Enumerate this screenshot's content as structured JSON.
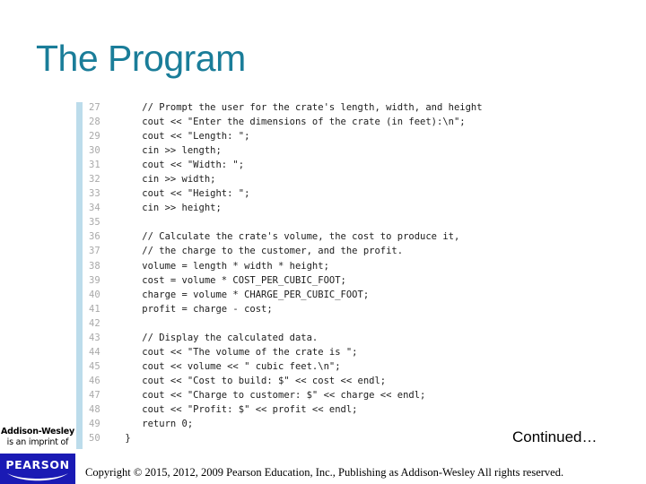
{
  "slide": {
    "title": "The Program",
    "title_color": "#1a7d99",
    "background_color": "#ffffff"
  },
  "code": {
    "left_rule_color": "#bcdceb",
    "line_number_color": "#a9a9a9",
    "text_color": "#1c1c1c",
    "lines": [
      {
        "number": "27",
        "text": "    // Prompt the user for the crate's length, width, and height"
      },
      {
        "number": "28",
        "text": "    cout << \"Enter the dimensions of the crate (in feet):\\n\";"
      },
      {
        "number": "29",
        "text": "    cout << \"Length: \";"
      },
      {
        "number": "30",
        "text": "    cin >> length;"
      },
      {
        "number": "31",
        "text": "    cout << \"Width: \";"
      },
      {
        "number": "32",
        "text": "    cin >> width;"
      },
      {
        "number": "33",
        "text": "    cout << \"Height: \";"
      },
      {
        "number": "34",
        "text": "    cin >> height;"
      },
      {
        "number": "35",
        "text": ""
      },
      {
        "number": "36",
        "text": "    // Calculate the crate's volume, the cost to produce it,"
      },
      {
        "number": "37",
        "text": "    // the charge to the customer, and the profit."
      },
      {
        "number": "38",
        "text": "    volume = length * width * height;"
      },
      {
        "number": "39",
        "text": "    cost = volume * COST_PER_CUBIC_FOOT;"
      },
      {
        "number": "40",
        "text": "    charge = volume * CHARGE_PER_CUBIC_FOOT;"
      },
      {
        "number": "41",
        "text": "    profit = charge - cost;"
      },
      {
        "number": "42",
        "text": ""
      },
      {
        "number": "43",
        "text": "    // Display the calculated data."
      },
      {
        "number": "44",
        "text": "    cout << \"The volume of the crate is \";"
      },
      {
        "number": "45",
        "text": "    cout << volume << \" cubic feet.\\n\";"
      },
      {
        "number": "46",
        "text": "    cout << \"Cost to build: $\" << cost << endl;"
      },
      {
        "number": "47",
        "text": "    cout << \"Charge to customer: $\" << charge << endl;"
      },
      {
        "number": "48",
        "text": "    cout << \"Profit: $\" << profit << endl;"
      },
      {
        "number": "49",
        "text": "    return 0;"
      },
      {
        "number": "50",
        "text": " }"
      }
    ]
  },
  "continued": {
    "label": "Continued…"
  },
  "footer": {
    "imprint_name": "Addison-Wesley",
    "imprint_subtitle": "is an imprint of",
    "publisher_wordmark": "PEARSON",
    "publisher_color": "#1a1ab4",
    "copyright": "Copyright © 2015, 2012, 2009 Pearson Education, Inc., Publishing as Addison-Wesley All rights reserved."
  }
}
